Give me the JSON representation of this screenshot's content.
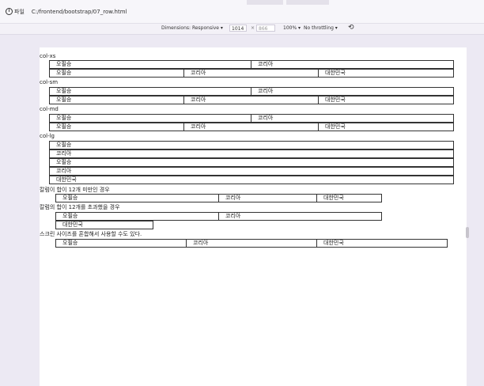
{
  "browser": {
    "info_label": "파일",
    "url": "C:/frontend/bootstrap/07_row.html"
  },
  "device_toolbar": {
    "dimensions_label": "Dimensions: Responsive ▾",
    "width": "1014",
    "x": "×",
    "height": "866",
    "zoom": "100% ▾",
    "throttling": "No throttling ▾"
  },
  "page": {
    "labels": {
      "xs": "col-xs",
      "sm": "col-sm",
      "md": "col-md",
      "lg": "col-lg",
      "under12": "칼럼이 합이 12개 미만인 경우",
      "over12": "칼럼의 합이 12개를 초과했을 경우",
      "mixed": "스크린 사이즈를 혼합해서 사용할 수도 있다."
    },
    "cells": {
      "a": "오필승",
      "b": "코리아",
      "c": "대한민국"
    }
  }
}
